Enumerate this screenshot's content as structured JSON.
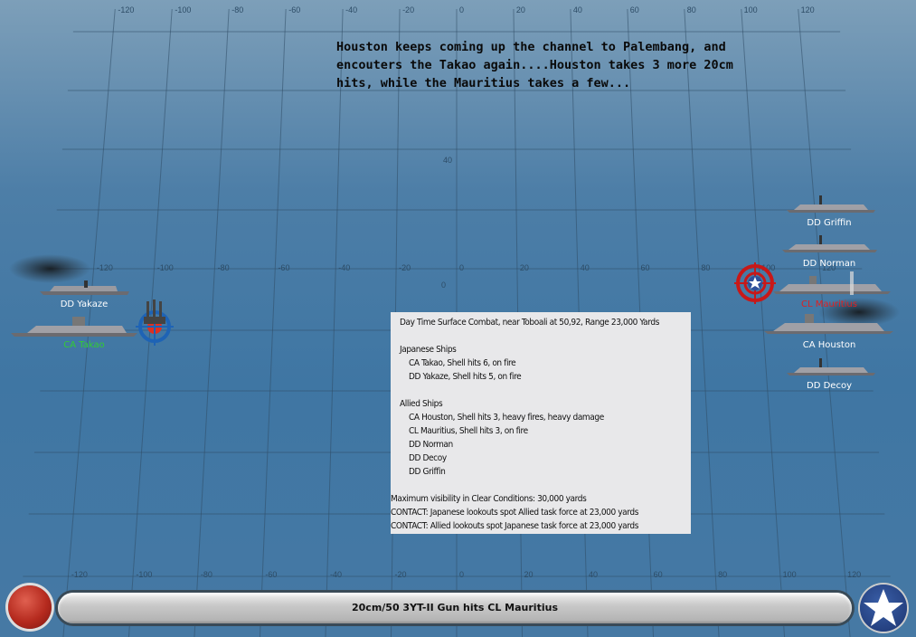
{
  "map": {
    "x_ticks": [
      "-120",
      "-100",
      "-80",
      "-60",
      "-40",
      "-20",
      "0",
      "20",
      "40",
      "60",
      "80",
      "100",
      "120"
    ],
    "y_ticks": [
      "40",
      "0"
    ]
  },
  "narration": "Houston keeps coming up the channel to Palembang, and encouters the Takao again....Houston takes 3 more 20cm hits, while the Mauritius takes a few...",
  "japanese_ships": [
    {
      "label": "DD Yakaze",
      "color": "#ffffff"
    },
    {
      "label": "CA Takao",
      "color": "#33cc33"
    }
  ],
  "allied_ships": [
    {
      "label": "DD Griffin",
      "color": "#ffffff"
    },
    {
      "label": "DD Norman",
      "color": "#ffffff"
    },
    {
      "label": "CL Mauritius",
      "color": "#e02020"
    },
    {
      "label": "CA Houston",
      "color": "#ffffff"
    },
    {
      "label": "DD Decoy",
      "color": "#ffffff"
    }
  ],
  "report": {
    "title": "Day Time Surface Combat, near Toboali at 50,92, Range 23,000 Yards",
    "japanese_header": "Japanese Ships",
    "japanese": [
      "CA Takao, Shell hits 6,  on fire",
      "DD Yakaze, Shell hits 5,  on fire"
    ],
    "allied_header": "Allied Ships",
    "allied": [
      "CA Houston, Shell hits 3,  heavy fires,  heavy damage",
      "CL Mauritius, Shell hits 3,  on fire",
      "DD Norman",
      "DD Decoy",
      "DD Griffin"
    ],
    "notes": [
      "Maximum visibility in Clear Conditions: 30,000 yards",
      "CONTACT: Japanese lookouts spot Allied task force at 23,000 yards",
      "CONTACT: Allied lookouts spot Japanese task force at 23,000 yards"
    ]
  },
  "status_bar": "20cm/50 3YT-II Gun hits CL Mauritius"
}
